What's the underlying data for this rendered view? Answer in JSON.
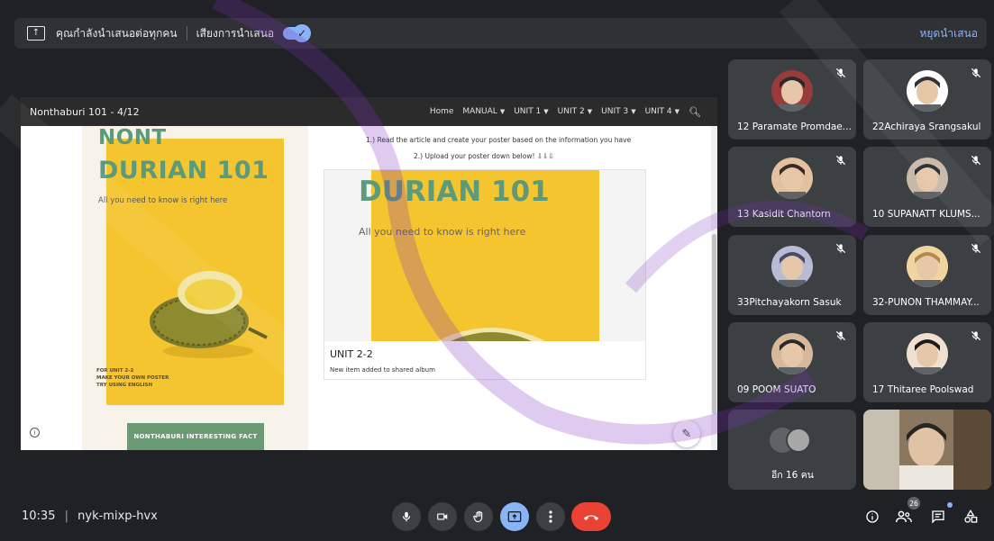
{
  "top_bar": {
    "presenting_text": "คุณกำลังนำเสนอต่อทุกคน",
    "audio_label": "เสียงการนำเสนอ",
    "audio_enabled": true,
    "stop_label": "หยุดนำเสนอ"
  },
  "presentation": {
    "site_title": "Nonthaburi 101 - 4/12",
    "nav": [
      {
        "label": "Home",
        "has_caret": false
      },
      {
        "label": "MANUAL",
        "has_caret": true
      },
      {
        "label": "UNIT 1",
        "has_caret": true
      },
      {
        "label": "UNIT 2",
        "has_caret": true
      },
      {
        "label": "UNIT 3",
        "has_caret": true
      },
      {
        "label": "UNIT 4",
        "has_caret": true
      }
    ],
    "left_poster": {
      "line1": "NONT",
      "line2": "DURIAN 101",
      "subtitle": "All you need to know is right here",
      "footer_lines": [
        "FOR UNIT 2-2",
        "MAKE YOUR OWN POSTER",
        "TRY USING ENGLISH"
      ],
      "banner": "NONTHABURI INTERESTING FACT"
    },
    "instructions": [
      "1.) Read the article and create your poster based on the information you have",
      "2.) Upload your poster down below! ⇩⇩⇩"
    ],
    "card": {
      "poster_title": "DURIAN 101",
      "poster_subtitle": "All you need to know is right here",
      "title": "UNIT 2-2",
      "description": "New item added to shared album"
    }
  },
  "participants": [
    {
      "name": "12 Paramate Promdae...",
      "muted": true
    },
    {
      "name": "22Achiraya Srangsakul",
      "muted": true
    },
    {
      "name": "13 Kasidit Chantorn",
      "muted": true
    },
    {
      "name": "10 SUPANATT KLUMS...",
      "muted": true
    },
    {
      "name": "33Pitchayakorn Sasuk",
      "muted": true
    },
    {
      "name": "32-PUNON THAMMAY...",
      "muted": true
    },
    {
      "name": "09 POOM SUATO",
      "muted": true
    },
    {
      "name": "17 Thitaree Poolswad",
      "muted": true
    }
  ],
  "more_tile": {
    "label": "อีก 16 คน"
  },
  "bottom_bar": {
    "time": "10:35",
    "separator": "|",
    "meeting_code": "nyk-mixp-hvx",
    "people_count": "26"
  },
  "colors": {
    "background": "#202124",
    "tile": "#3c4043",
    "accent": "#8ab4f8",
    "end_call": "#ea4335",
    "poster_yellow": "#f4c52f",
    "poster_green": "#5b9a7b"
  },
  "icons": {
    "present": "present-screen-icon",
    "mic": "microphone-icon",
    "camera": "camera-icon",
    "hand": "raise-hand-icon",
    "present_now": "present-now-icon",
    "more": "more-options-icon",
    "end": "end-call-icon",
    "info": "info-icon",
    "people": "people-icon",
    "chat": "chat-icon",
    "activities": "activities-icon"
  }
}
